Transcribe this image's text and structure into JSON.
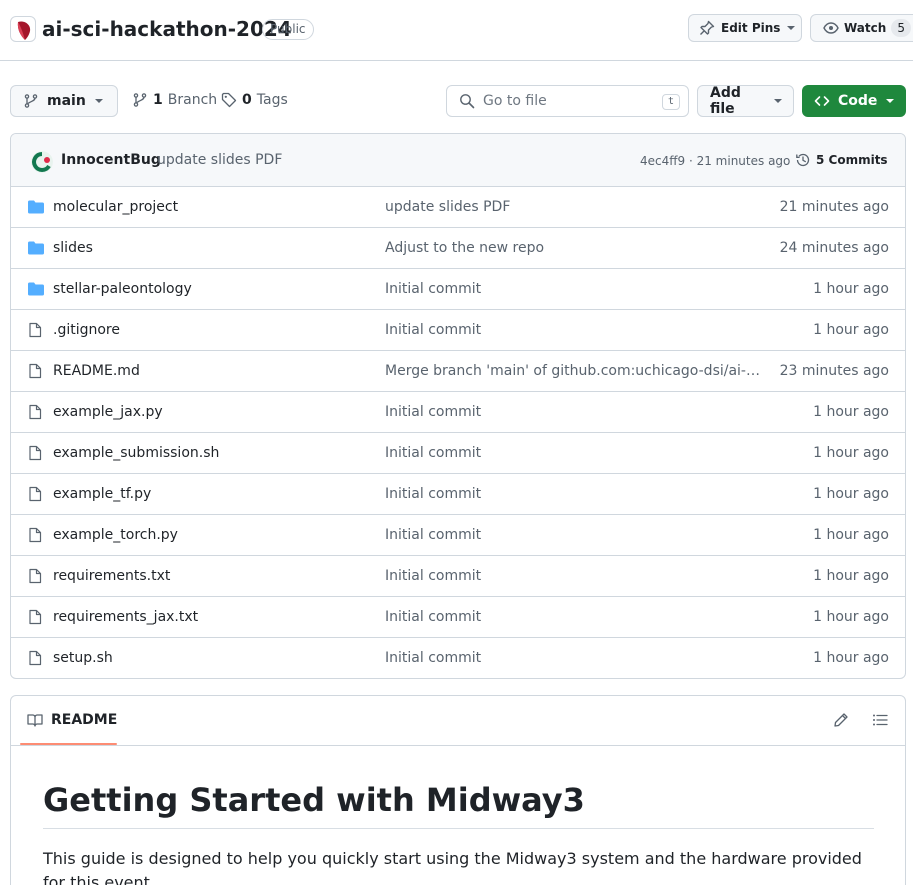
{
  "repo": {
    "name": "ai-sci-hackathon-2024",
    "visibility": "Public",
    "edit_pins_label": "Edit Pins",
    "watch_label": "Watch",
    "watch_count": "5"
  },
  "toolbar": {
    "branch": "main",
    "branches_count": "1",
    "branches_label": "Branch",
    "tags_count": "0",
    "tags_label": "Tags",
    "goto_placeholder": "Go to file",
    "goto_shortcut": "t",
    "add_file_label": "Add file",
    "code_label": "Code",
    "code_color": "#1f883d"
  },
  "latest_commit": {
    "author": "InnocentBug",
    "message": "update slides PDF",
    "meta": "4ec4ff9 · 21 minutes ago",
    "commits_label": "5 Commits"
  },
  "files": [
    {
      "name": "molecular_project",
      "type": "folder",
      "message": "update slides PDF",
      "time": "21 minutes ago"
    },
    {
      "name": "slides",
      "type": "folder",
      "message": "Adjust to the new repo",
      "time": "24 minutes ago"
    },
    {
      "name": "stellar-paleontology",
      "type": "folder",
      "message": "Initial commit",
      "time": "1 hour ago"
    },
    {
      "name": ".gitignore",
      "type": "file",
      "message": "Initial commit",
      "time": "1 hour ago"
    },
    {
      "name": "README.md",
      "type": "file",
      "message": "Merge branch 'main' of github.com:uchicago-dsi/ai-sci-h...",
      "time": "23 minutes ago"
    },
    {
      "name": "example_jax.py",
      "type": "file",
      "message": "Initial commit",
      "time": "1 hour ago"
    },
    {
      "name": "example_submission.sh",
      "type": "file",
      "message": "Initial commit",
      "time": "1 hour ago"
    },
    {
      "name": "example_tf.py",
      "type": "file",
      "message": "Initial commit",
      "time": "1 hour ago"
    },
    {
      "name": "example_torch.py",
      "type": "file",
      "message": "Initial commit",
      "time": "1 hour ago"
    },
    {
      "name": "requirements.txt",
      "type": "file",
      "message": "Initial commit",
      "time": "1 hour ago"
    },
    {
      "name": "requirements_jax.txt",
      "type": "file",
      "message": "Initial commit",
      "time": "1 hour ago"
    },
    {
      "name": "setup.sh",
      "type": "file",
      "message": "Initial commit",
      "time": "1 hour ago"
    }
  ],
  "readme": {
    "tab_label": "README",
    "heading": "Getting Started with Midway3",
    "intro": "This guide is designed to help you quickly start using the Midway3 system and the hardware provided for this event."
  },
  "colors": {
    "folder": "#54aeff",
    "file_icon": "#59636e",
    "accent_underline": "#fd8c73"
  },
  "icons": {
    "repo_avatar": "org-logo-icon",
    "pin": "pin-icon",
    "eye": "eye-icon",
    "branch": "git-branch-icon",
    "tag": "tag-icon",
    "search": "search-icon",
    "code": "code-icon",
    "history": "history-icon",
    "folder": "folder-icon",
    "file": "file-icon",
    "book": "book-icon",
    "pencil": "pencil-icon",
    "list": "list-unordered-icon"
  }
}
